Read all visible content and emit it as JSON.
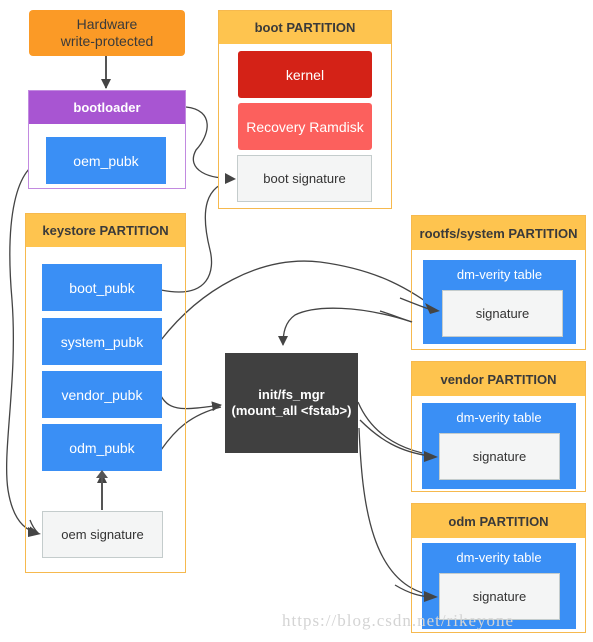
{
  "colors": {
    "hardware": "#fb9a26",
    "bootloader_head": "#a855d2",
    "bootloader_border": "#c28ae0",
    "partition_head": "#fec44f",
    "partition_border": "#f6b94e",
    "key_blue": "#3a8ff5",
    "kernel_red": "#d42217",
    "recovery_red": "#fc605d",
    "signature_gray": "#f4f5f5",
    "init_dark": "#404040",
    "wire": "#444444"
  },
  "hardware": {
    "line1": "Hardware",
    "line2": "write-protected"
  },
  "bootloader": {
    "title": "bootloader",
    "key": "oem_pubk"
  },
  "boot_partition": {
    "title": "boot PARTITION",
    "kernel": "kernel",
    "recovery": "Recovery Ramdisk",
    "signature": "boot signature"
  },
  "keystore_partition": {
    "title": "keystore PARTITION",
    "keys": [
      "boot_pubk",
      "system_pubk",
      "vendor_pubk",
      "odm_pubk"
    ],
    "signature": "oem signature"
  },
  "init": {
    "line1": "init/fs_mgr",
    "line2": "(mount_all <fstab>)"
  },
  "system_partition": {
    "title": "rootfs/system PARTITION",
    "table": "dm-verity table",
    "signature": "signature"
  },
  "vendor_partition": {
    "title": "vendor PARTITION",
    "table": "dm-verity table",
    "signature": "signature"
  },
  "odm_partition": {
    "title": "odm PARTITION",
    "table": "dm-verity table",
    "signature": "signature"
  },
  "watermark": "https://blog.csdn.net/rikeyone"
}
